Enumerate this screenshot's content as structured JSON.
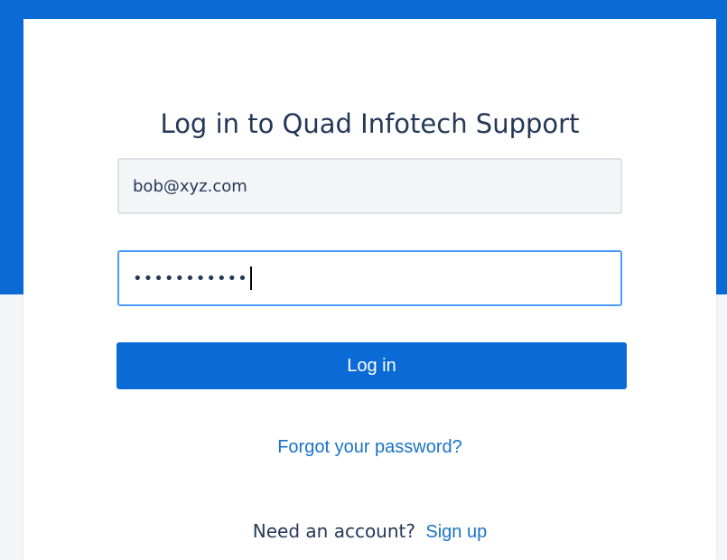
{
  "login": {
    "title": "Log in to Quad Infotech Support",
    "email_value": "bob@xyz.com",
    "password_mask": "•••••••••••",
    "button_label": "Log in",
    "forgot_label": "Forgot your password?",
    "account_prompt": "Need an account?",
    "signup_label": "Sign up"
  },
  "colors": {
    "accent": "#0b6bd6",
    "link": "#1a73c7",
    "text": "#253858",
    "focus_border": "#4c9aff"
  }
}
